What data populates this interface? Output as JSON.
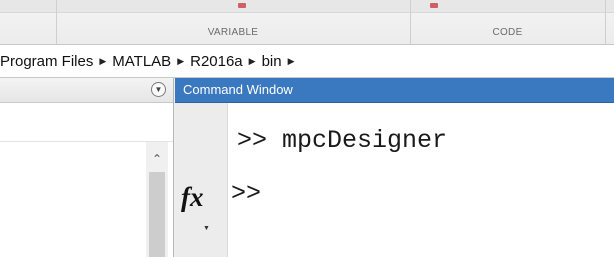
{
  "ribbon": {
    "groups": [
      "VARIABLE",
      "CODE"
    ]
  },
  "breadcrumb": {
    "items": [
      "Program Files",
      "MATLAB",
      "R2016a",
      "bin"
    ]
  },
  "current_folder": {
    "menu_icon": "chevron-down-circle-icon",
    "scroll_up_icon": "chevron-up-icon"
  },
  "command_window": {
    "title": "Command Window",
    "fx_icon": "fx",
    "lines": [
      {
        "prompt": ">>",
        "command": " mpcDesigner"
      },
      {
        "prompt": ">>",
        "command": ""
      }
    ]
  },
  "colors": {
    "title_bar": "#3a78bf",
    "ribbon_bg": "#ececec"
  }
}
